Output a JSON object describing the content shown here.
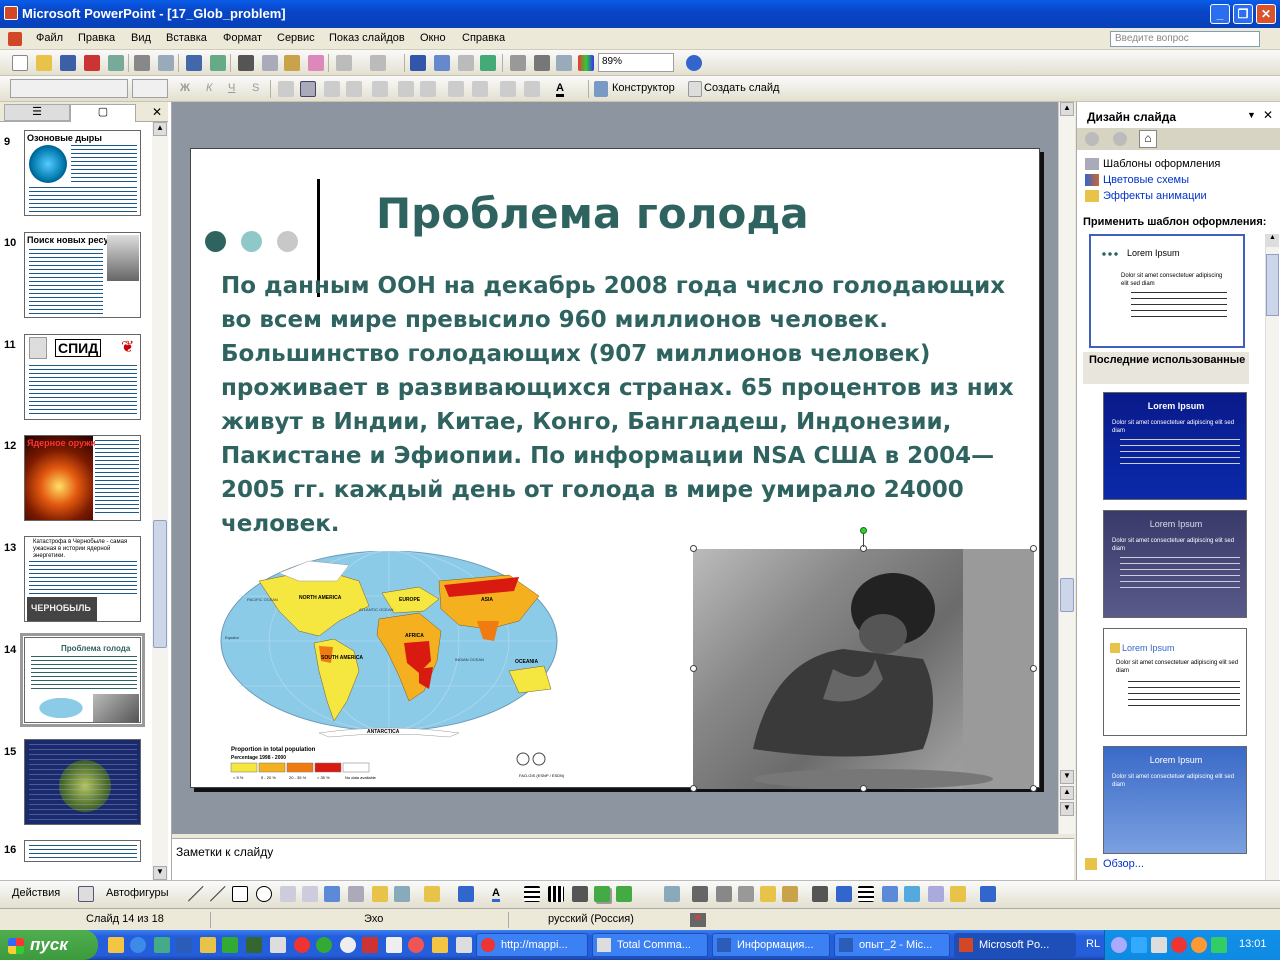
{
  "window": {
    "title": "Microsoft PowerPoint - [17_Glob_problem]"
  },
  "menu": [
    "Файл",
    "Правка",
    "Вид",
    "Вставка",
    "Формат",
    "Сервис",
    "Показ слайдов",
    "Окно",
    "Справка"
  ],
  "ask_placeholder": "Введите вопрос",
  "toolbar": {
    "zoom": "89%",
    "designer": "Конструктор",
    "new_slide": "Создать слайд"
  },
  "slides_panel": {
    "thumbs": [
      {
        "num": "9",
        "title": "Озоновые дыры"
      },
      {
        "num": "10",
        "title": "Поиск новых ресурсов"
      },
      {
        "num": "11",
        "title": "СПИД"
      },
      {
        "num": "12",
        "title": "Ядерное оружие"
      },
      {
        "num": "13",
        "title": "Катастрофа в Чернобыле - самая ужасная в истории ядерной энергетики.",
        "caption": "ЧЕРНОБЫЛЬ"
      },
      {
        "num": "14",
        "title": "Проблема голода"
      },
      {
        "num": "15",
        "title": ""
      },
      {
        "num": "16",
        "title": ""
      }
    ]
  },
  "slide": {
    "title": "Проблема голода",
    "body": "По данным ООН на декабрь 2008 года число голодающих во всем мире превысило 960 миллионов человек. Большинство голодающих (907 миллионов человек) проживает в развивающихся странах. 65 процентов из них живут в Индии, Китае, Конго, Бангладеш, Индонезии, Пакистане и Эфиопии. По информации NSA США в 2004—2005 гг. каждый день от голода в мире умирало 24000 человек.",
    "map": {
      "legend_title": "Proportion in total population",
      "legend_subtitle": "Percentage 1998 - 2000",
      "legend_items": [
        "< 5 %",
        "5 - 20 %",
        "20 - 35 %",
        "> 35 %",
        "No data available"
      ],
      "legend_colors": [
        "#f5e640",
        "#f5b020",
        "#f07b10",
        "#d91a10",
        "#ffffff"
      ],
      "source": "FAO-GIS (ESNP / ESDN)",
      "regions": [
        "NORTH AMERICA",
        "SOUTH AMERICA",
        "EUROPE",
        "ASIA",
        "AFRICA",
        "OCEANIA",
        "ANTARCTICA",
        "PACIFIC OCEAN",
        "ATLANTIC OCEAN",
        "INDIAN OCEAN",
        "Equator"
      ]
    }
  },
  "notes_placeholder": "Заметки к слайду",
  "task_pane": {
    "title": "Дизайн слайда",
    "links": [
      "Шаблоны оформления",
      "Цветовые схемы",
      "Эффекты анимации"
    ],
    "apply_label": "Применить шаблон оформления:",
    "recent_label": "Последние использованные",
    "template_text": "Lorem Ipsum",
    "template_bullet": "Dolor sit amet consectetuer adipiscing elit sed diam",
    "browse": "Обзор..."
  },
  "drawbar": {
    "actions": "Действия",
    "autoshapes": "Автофигуры"
  },
  "status": {
    "slide": "Слайд 14 из 18",
    "design": "Эхо",
    "language": "русский (Россия)"
  },
  "taskbar": {
    "start": "пуск",
    "tasks": [
      "http://mappi...",
      "Total Comma...",
      "Информация...",
      "опыт_2 - Mic...",
      "Microsoft Po..."
    ],
    "lang": "RL",
    "clock": "13:01"
  }
}
